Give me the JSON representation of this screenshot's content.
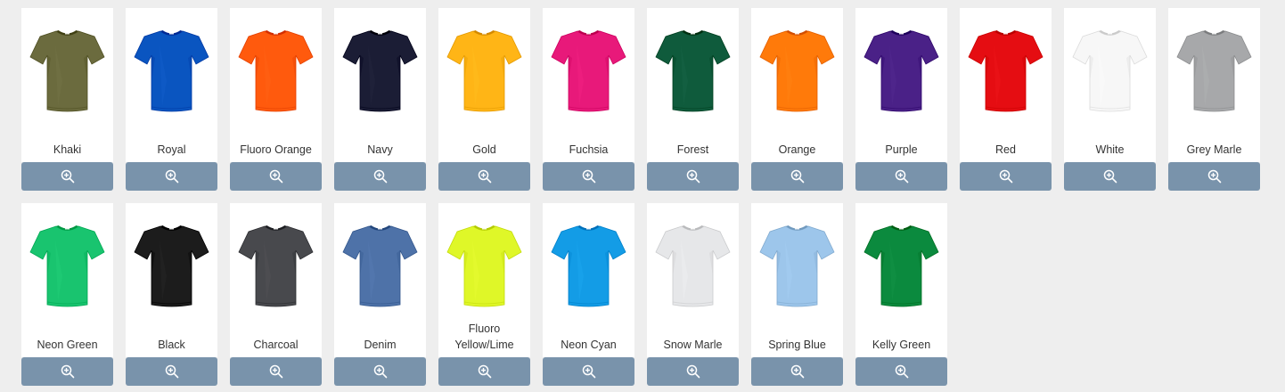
{
  "swatches": [
    {
      "name": "Khaki",
      "color": "#6b6b3e"
    },
    {
      "name": "Royal",
      "color": "#0a55c0"
    },
    {
      "name": "Fluoro Orange",
      "color": "#ff5a0d"
    },
    {
      "name": "Navy",
      "color": "#1b1d35"
    },
    {
      "name": "Gold",
      "color": "#ffb516"
    },
    {
      "name": "Fuchsia",
      "color": "#e8197a"
    },
    {
      "name": "Forest",
      "color": "#0f5b3c"
    },
    {
      "name": "Orange",
      "color": "#ff7a0a"
    },
    {
      "name": "Purple",
      "color": "#4a2187"
    },
    {
      "name": "Red",
      "color": "#e50d12"
    },
    {
      "name": "White",
      "color": "#f7f7f7"
    },
    {
      "name": "Grey Marle",
      "color": "#a7a8aa"
    },
    {
      "name": "Neon Green",
      "color": "#19c46f"
    },
    {
      "name": "Black",
      "color": "#1c1c1c"
    },
    {
      "name": "Charcoal",
      "color": "#48494d"
    },
    {
      "name": "Denim",
      "color": "#4e72a8"
    },
    {
      "name": "Fluoro Yellow/Lime",
      "color": "#dff728"
    },
    {
      "name": "Neon Cyan",
      "color": "#139ce6"
    },
    {
      "name": "Snow Marle",
      "color": "#e6e7e9"
    },
    {
      "name": "Spring Blue",
      "color": "#9dc6eb"
    },
    {
      "name": "Kelly Green",
      "color": "#0b8a3e"
    }
  ],
  "zoom_icon": "zoom-in-icon",
  "zoom_button_color": "#7993ab"
}
